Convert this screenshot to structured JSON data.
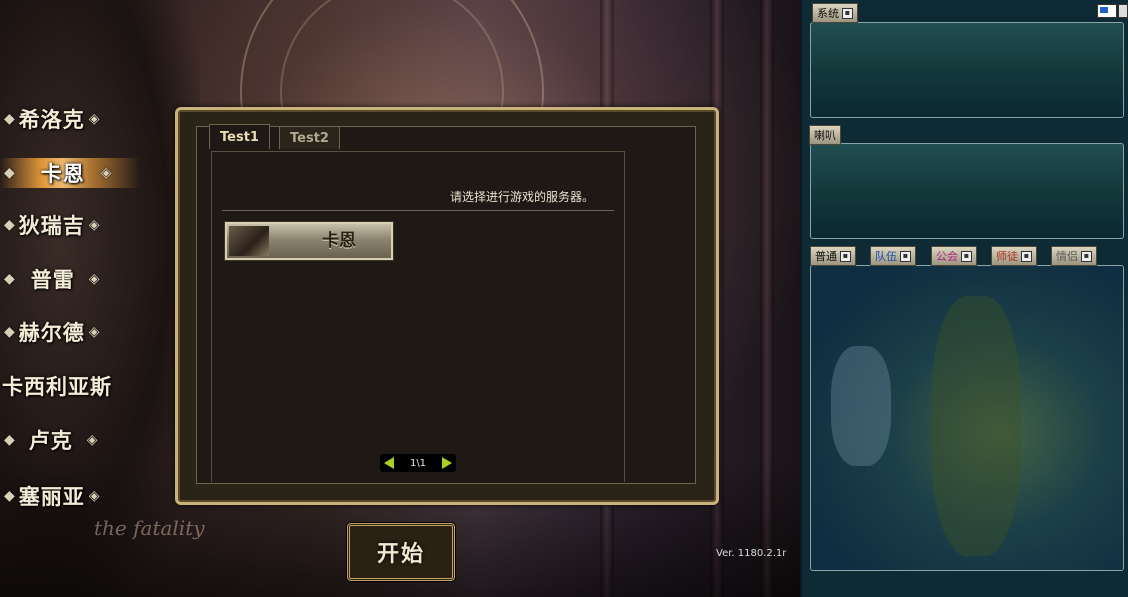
{
  "servers": {
    "items": [
      {
        "label": "希洛克"
      },
      {
        "label": "卡恩"
      },
      {
        "label": "狄瑞吉"
      },
      {
        "label": "普雷"
      },
      {
        "label": "赫尔德"
      },
      {
        "label": "卡西利亚斯"
      },
      {
        "label": "卢克"
      },
      {
        "label": "塞丽亚"
      }
    ],
    "selected_index": 1
  },
  "dialog": {
    "tabs": [
      {
        "label": "Test1"
      },
      {
        "label": "Test2"
      }
    ],
    "active_tab": 0,
    "prompt": "请选择进行游戏的服务器。",
    "server_button": "卡恩",
    "pager": "1\\1"
  },
  "start_button": "开始",
  "version": "Ver. 1180.2.1r",
  "background_text": "the fatality",
  "chat": {
    "system_label": "系统",
    "horn_label": "喇叭",
    "tabs": [
      {
        "label": "普通",
        "color": "#111111"
      },
      {
        "label": "队伍",
        "color": "#1a4aa8"
      },
      {
        "label": "公会",
        "color": "#b02080"
      },
      {
        "label": "师徒",
        "color": "#b03020"
      },
      {
        "label": "情侣",
        "color": "#5a5a5a"
      }
    ]
  },
  "colors": {
    "accent_gold": "#c8b47a",
    "pager_arrow": "#a8d020",
    "chat_bg": "#0e2a34"
  }
}
